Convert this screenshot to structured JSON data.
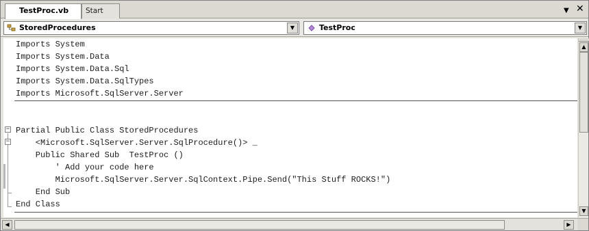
{
  "tabs": [
    {
      "label": "TestProc.vb",
      "active": true
    },
    {
      "label": "Start Page",
      "active": false
    }
  ],
  "tab_controls": {
    "dropdown_icon": "triangle-down-icon",
    "close_icon": "close-icon"
  },
  "combos": {
    "left": {
      "value": "StoredProcedures",
      "icon": "class-icon"
    },
    "right": {
      "value": "TestProc",
      "icon": "method-icon"
    }
  },
  "code_lines": [
    "Imports System",
    "Imports System.Data",
    "Imports System.Data.Sql",
    "Imports System.Data.SqlTypes",
    "Imports Microsoft.SqlServer.Server",
    "",
    "",
    "Partial Public Class StoredProcedures",
    "    <Microsoft.SqlServer.Server.SqlProcedure()> _",
    "    Public Shared Sub  TestProc ()",
    "        ' Add your code here",
    "        Microsoft.SqlServer.Server.SqlContext.Pipe.Send(\"This Stuff ROCKS!\")",
    "    End Sub",
    "End Class"
  ],
  "colors": {
    "background": "#d4d0c8",
    "editor": "#ffffff",
    "text": "#1c1c1c"
  }
}
